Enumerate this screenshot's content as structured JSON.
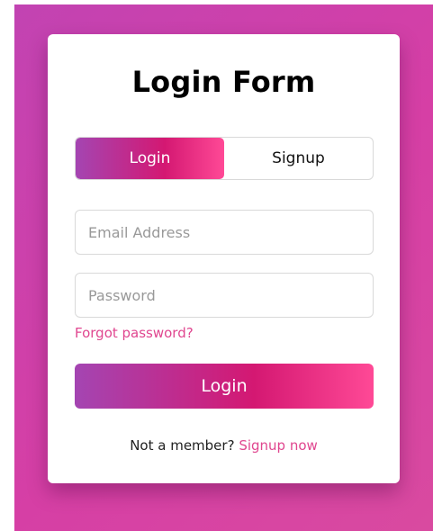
{
  "form": {
    "title": "Login Form",
    "tabs": [
      {
        "label": "Login",
        "active": true
      },
      {
        "label": "Signup",
        "active": false
      }
    ],
    "email": {
      "value": "",
      "placeholder": "Email Address"
    },
    "password": {
      "value": "",
      "placeholder": "Password"
    },
    "forgot_label": "Forgot password?",
    "submit_label": "Login",
    "signup_prompt": "Not a member?",
    "signup_link": "Signup now"
  },
  "colors": {
    "background": "#d63fa5",
    "gradient_start": "#a445b2",
    "gradient_end": "#ff4996",
    "link": "#e0468f"
  }
}
